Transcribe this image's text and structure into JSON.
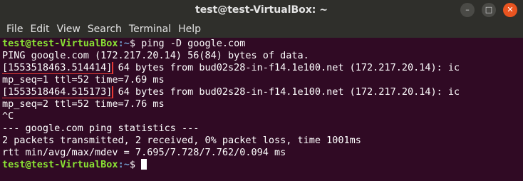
{
  "window": {
    "title": "test@test-VirtualBox: ~",
    "buttons": [
      "–",
      "□",
      "✕"
    ]
  },
  "menu": [
    "File",
    "Edit",
    "View",
    "Search",
    "Terminal",
    "Help"
  ],
  "prompt": {
    "user": "test@test-VirtualBox",
    "path": ":~",
    "symbol": "$"
  },
  "terminal": {
    "command": " ping -D google.com",
    "line_ping": "PING google.com (172.217.20.14) 56(84) bytes of data.",
    "ts1": "[1553518463.514414]",
    "reply1": " 64 bytes from bud02s28-in-f14.1e100.net (172.217.20.14): ic",
    "reply1_wrap": "mp_seq=1 ttl=52 time=7.69 ms",
    "ts2": "[1553518464.515173]",
    "reply2": " 64 bytes from bud02s28-in-f14.1e100.net (172.217.20.14): ic",
    "reply2_wrap": "mp_seq=2 ttl=52 time=7.76 ms",
    "interrupt": "^C",
    "stats_header": "--- google.com ping statistics ---",
    "stats_packets": "2 packets transmitted, 2 received, 0% packet loss, time 1001ms",
    "stats_rtt": "rtt min/avg/max/mdev = 7.695/7.728/7.762/0.094 ms"
  },
  "colors": {
    "background": "#300a24",
    "prompt_user": "#8ae234",
    "prompt_path": "#729fcf",
    "highlight_box": "#e53935"
  }
}
